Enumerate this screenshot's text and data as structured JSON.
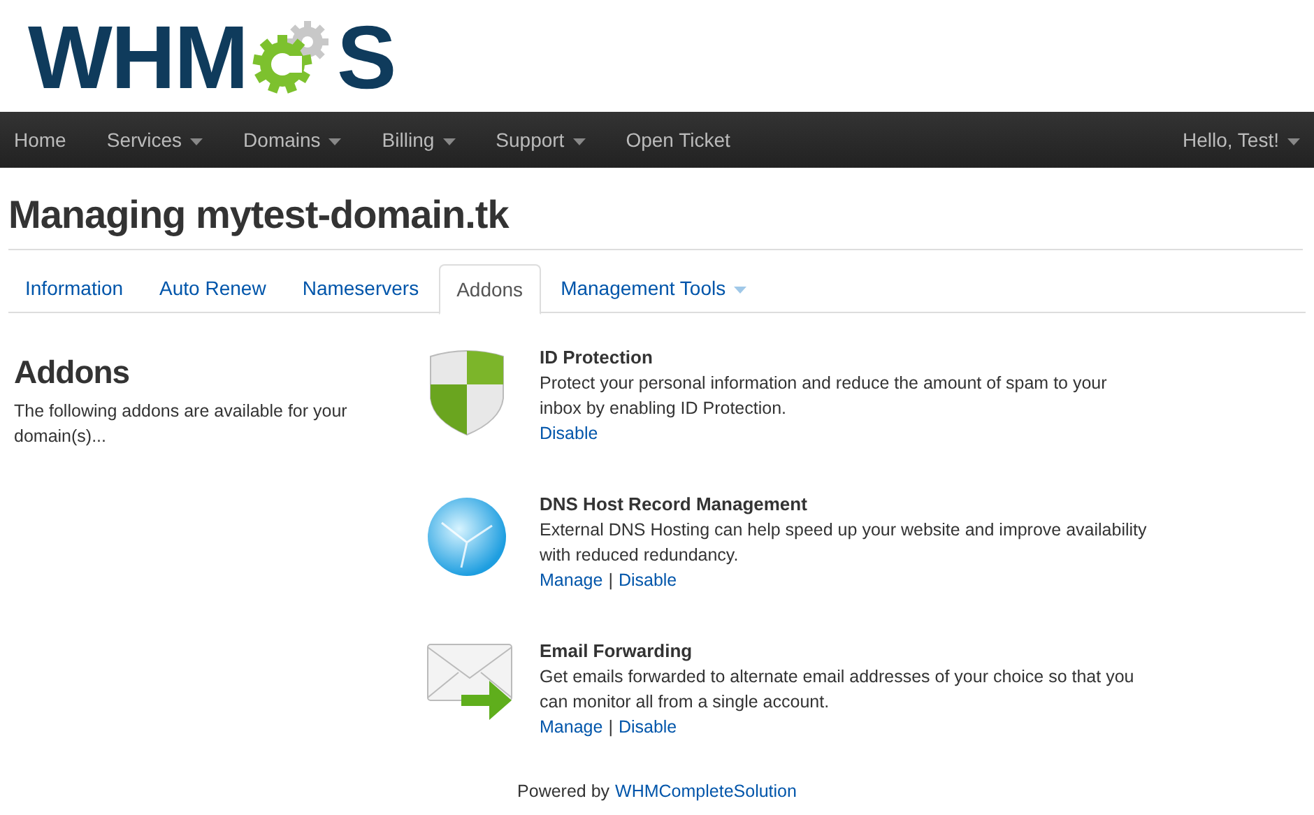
{
  "logo": {
    "before": "WHM",
    "after": "S"
  },
  "nav": {
    "items": [
      {
        "label": "Home",
        "has_menu": false
      },
      {
        "label": "Services",
        "has_menu": true
      },
      {
        "label": "Domains",
        "has_menu": true
      },
      {
        "label": "Billing",
        "has_menu": true
      },
      {
        "label": "Support",
        "has_menu": true
      },
      {
        "label": "Open Ticket",
        "has_menu": false
      }
    ],
    "user": {
      "label": "Hello, Test!",
      "has_menu": true
    }
  },
  "page_title": "Managing mytest-domain.tk",
  "tabs": [
    {
      "label": "Information",
      "selected": false,
      "has_menu": false
    },
    {
      "label": "Auto Renew",
      "selected": false,
      "has_menu": false
    },
    {
      "label": "Nameservers",
      "selected": false,
      "has_menu": false
    },
    {
      "label": "Addons",
      "selected": true,
      "has_menu": false
    },
    {
      "label": "Management Tools",
      "selected": false,
      "has_menu": true
    }
  ],
  "sidebar": {
    "heading": "Addons",
    "text": "The following addons are available for your domain(s)..."
  },
  "addons": [
    {
      "kind": "shield",
      "title": "ID Protection",
      "description": "Protect your personal information and reduce the amount of spam to your inbox by enabling ID Protection.",
      "actions": [
        "Disable"
      ]
    },
    {
      "kind": "globe",
      "title": "DNS Host Record Management",
      "description": "External DNS Hosting can help speed up your website and improve availability with reduced redundancy.",
      "actions": [
        "Manage",
        "Disable"
      ]
    },
    {
      "kind": "envelope",
      "title": "Email Forwarding",
      "description": "Get emails forwarded to alternate email addresses of your choice so that you can monitor all from a single account.",
      "actions": [
        "Manage",
        "Disable"
      ]
    }
  ],
  "action_separator": "|",
  "footer": {
    "text": "Powered by",
    "link": "WHMCompleteSolution"
  }
}
